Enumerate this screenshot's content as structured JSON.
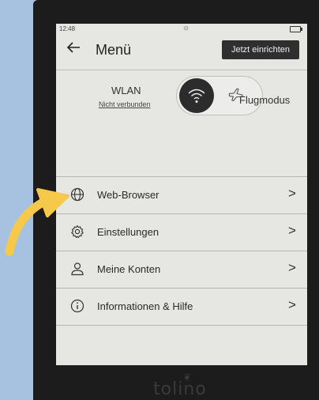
{
  "status_bar": {
    "time": "12:48"
  },
  "header": {
    "back_icon": "arrow-left-icon",
    "title": "Menü",
    "setup_button": "Jetzt einrichten"
  },
  "connectivity": {
    "wlan_label": "WLAN",
    "wlan_status": "Nicht verbunden",
    "flight_mode_label": "Flugmodus",
    "selected": "wlan"
  },
  "menu_items": [
    {
      "icon": "globe-icon",
      "label": "Web-Browser"
    },
    {
      "icon": "gear-icon",
      "label": "Einstellungen"
    },
    {
      "icon": "user-icon",
      "label": "Meine Konten"
    },
    {
      "icon": "info-icon",
      "label": "Informationen & Hilfe"
    }
  ],
  "brand": {
    "logo": "tolino"
  },
  "colors": {
    "background": "#a7c2e0",
    "device": "#1c1c1c",
    "screen": "#e6e6e3",
    "arrow": "#f6c94a"
  }
}
